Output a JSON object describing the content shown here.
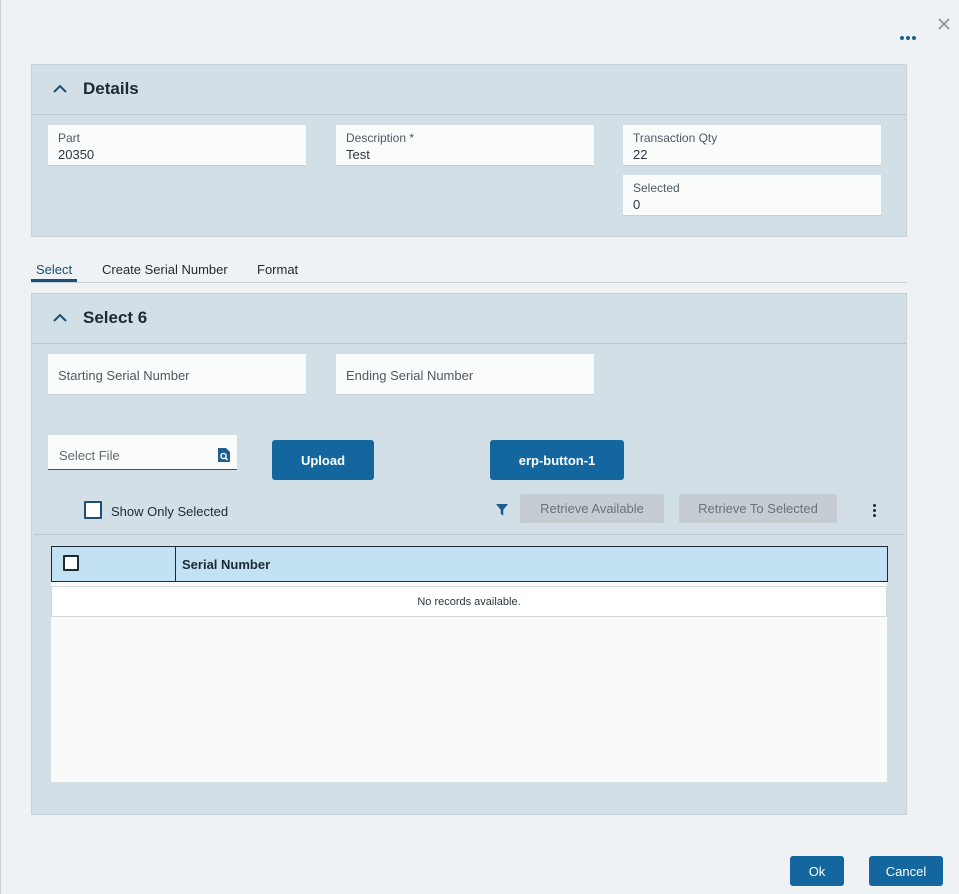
{
  "details": {
    "title": "Details",
    "part": {
      "label": "Part",
      "value": "20350"
    },
    "description": {
      "label": "Description *",
      "value": "Test"
    },
    "transaction_qty": {
      "label": "Transaction Qty",
      "value": "22"
    },
    "selected": {
      "label": "Selected",
      "value": "0"
    }
  },
  "tabs": [
    {
      "label": "Select",
      "active": true
    },
    {
      "label": "Create Serial Number",
      "active": false
    },
    {
      "label": "Format",
      "active": false
    }
  ],
  "select_panel": {
    "title": "Select 6",
    "starting_serial_placeholder": "Starting Serial Number",
    "ending_serial_placeholder": "Ending Serial Number",
    "select_file_placeholder": "Select File",
    "upload_label": "Upload",
    "erp_button_label": "erp-button-1",
    "show_only_selected_label": "Show Only Selected",
    "retrieve_available_label": "Retrieve Available",
    "retrieve_to_selected_label": "Retrieve To Selected"
  },
  "grid": {
    "columns": [
      "Serial Number"
    ],
    "empty_message": "No records available."
  },
  "footer": {
    "ok_label": "Ok",
    "cancel_label": "Cancel"
  },
  "colors": {
    "primary": "#13679e",
    "panel_bg": "#d3dfe6",
    "grid_header": "#c2e1f3"
  }
}
